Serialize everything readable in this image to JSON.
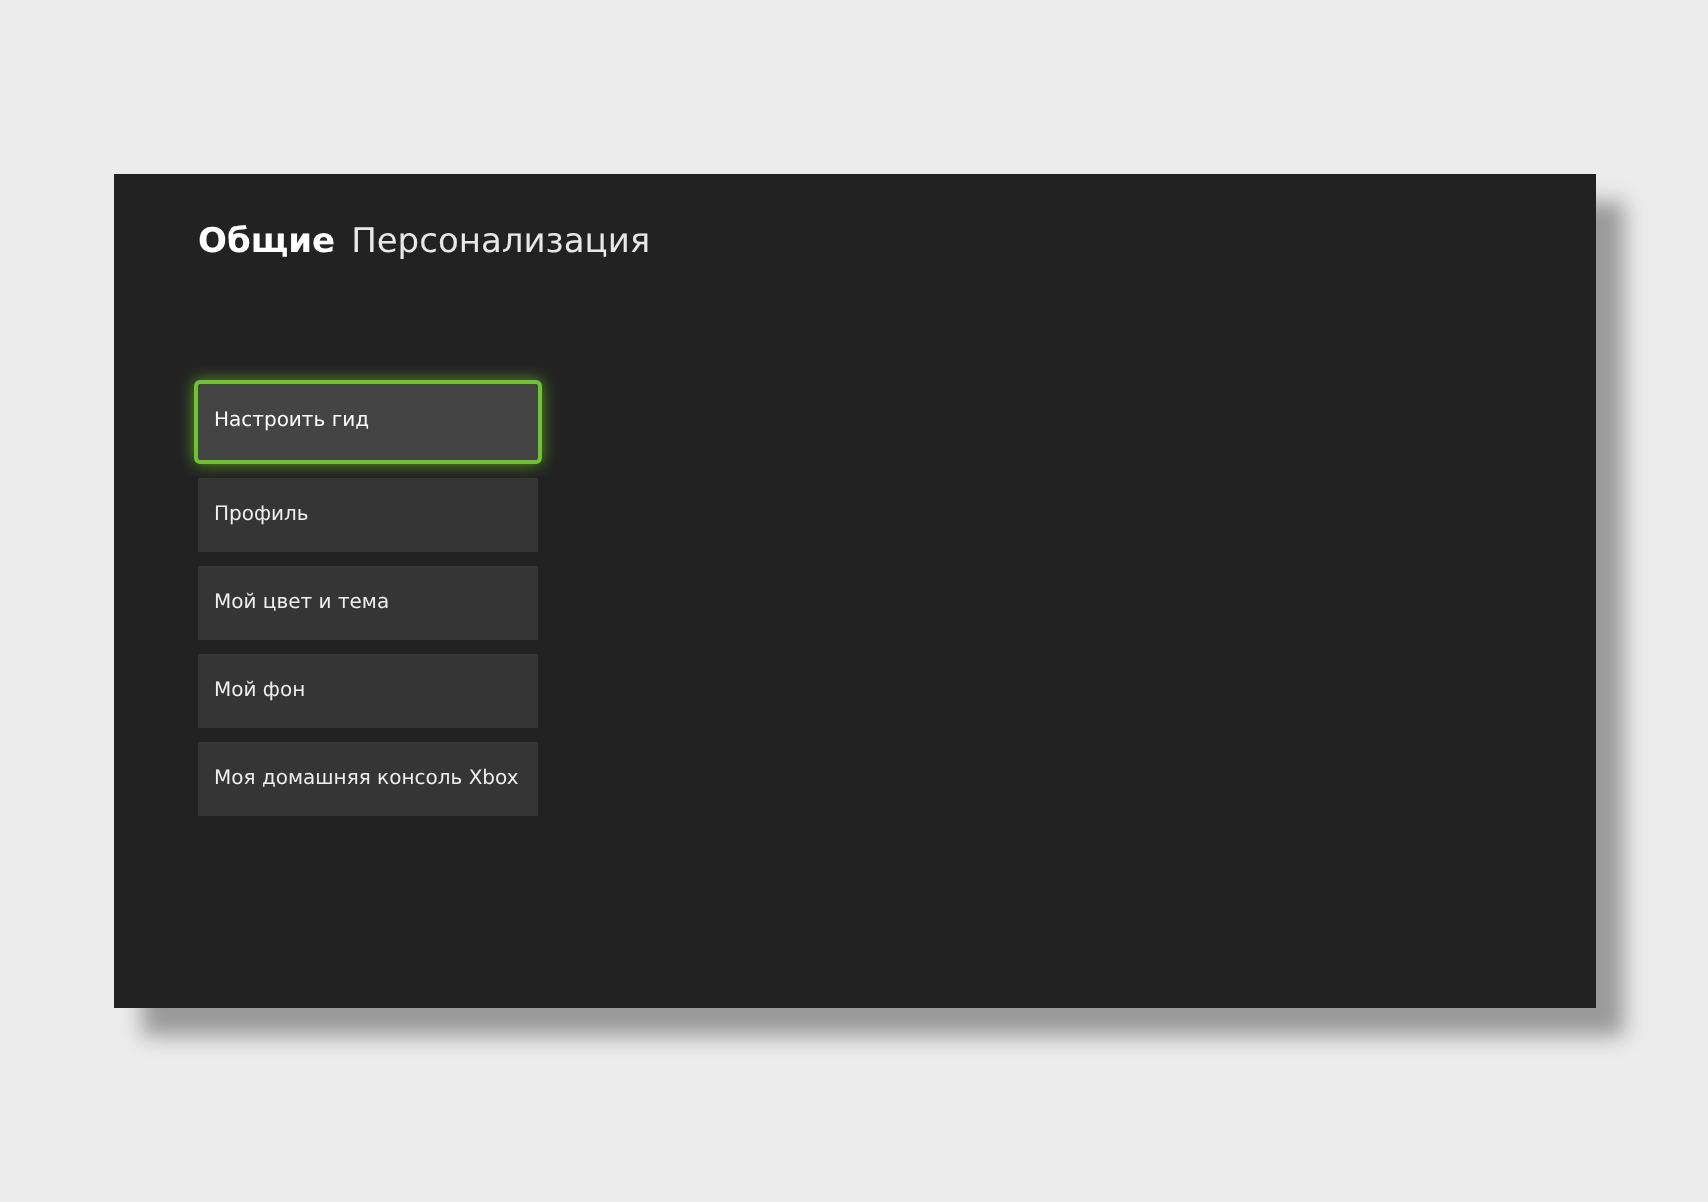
{
  "breadcrumb": {
    "section": "Общие",
    "page": "Персонализация"
  },
  "menu": [
    {
      "label": "Настроить гид",
      "selected": true
    },
    {
      "label": "Профиль",
      "selected": false
    },
    {
      "label": "Мой цвет и тема",
      "selected": false
    },
    {
      "label": "Мой фон",
      "selected": false
    },
    {
      "label": "Моя домашняя консоль Xbox",
      "selected": false
    }
  ]
}
